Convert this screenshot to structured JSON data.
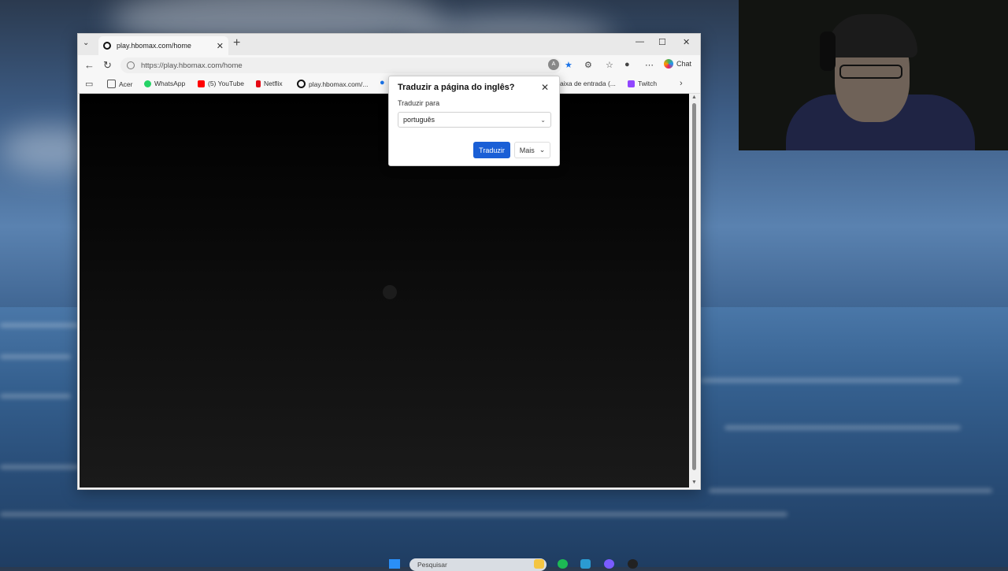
{
  "browser": {
    "tab": {
      "title": "play.hbomax.com/home",
      "favicon": "hbomax-icon"
    },
    "address": "https://play.hbomax.com/home",
    "chat_label": "Chat",
    "favorites": [
      {
        "label": "Acer",
        "icon": "folder-icon",
        "color": "#555555"
      },
      {
        "label": "WhatsApp",
        "icon": "whatsapp-icon",
        "color": "#25d366"
      },
      {
        "label": "(5) YouTube",
        "icon": "youtube-icon",
        "color": "#ff0000"
      },
      {
        "label": "Netflix",
        "icon": "netflix-icon",
        "color": "#e50914"
      },
      {
        "label": "play.hbomax.com/...",
        "icon": "hbomax-icon",
        "color": "#111111"
      },
      {
        "label": "aixa de entrada (...",
        "icon": "mail-icon",
        "color": "#1a73e8"
      },
      {
        "label": "Twitch",
        "icon": "twitch-icon",
        "color": "#9146ff"
      }
    ]
  },
  "translate_popup": {
    "title": "Traduzir a página do inglês?",
    "label": "Traduzir para",
    "language": "português",
    "translate_button": "Traduzir",
    "more_button": "Mais"
  },
  "taskbar": {
    "search_placeholder": "Pesquisar"
  },
  "colors": {
    "accent": "#1a5fd6",
    "star": "#1a73e8"
  }
}
